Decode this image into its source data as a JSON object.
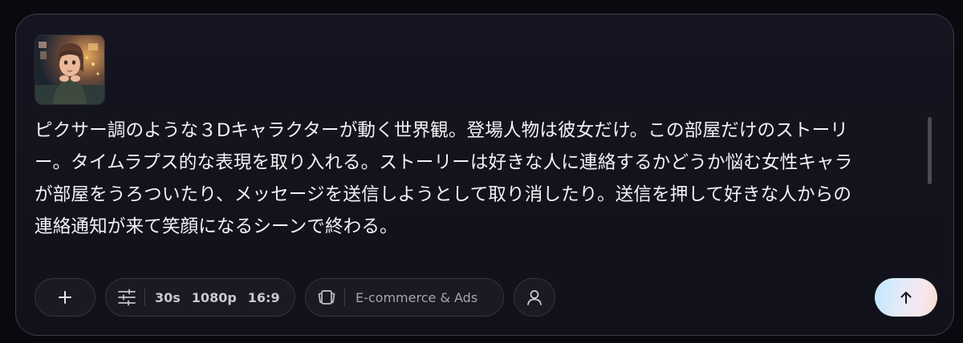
{
  "attachment": {
    "icon": "character-image-thumbnail"
  },
  "prompt": {
    "line1": "ピクサー調のような３Dキャラクターが動く世界観。登場人物は彼女だけ。この部屋だけのストーリ",
    "line2": "ー。タイムラプス的な表現を取り入れる。ストーリーは好きな人に連絡するかどうか悩む女性キャラ",
    "line3": "が部屋をうろついたり、メッセージを送信しようとして取り消したり。送信を押して好きな人からの",
    "line4": "連絡通知が来て笑顔になるシーンで終わる。"
  },
  "toolbar": {
    "add_icon": "plus-icon",
    "settings_icon": "sliders-icon",
    "duration": "30s",
    "resolution": "1080p",
    "aspect_ratio": "16:9",
    "category_icon": "cards-icon",
    "category_label": "E-commerce & Ads",
    "character_icon": "user-icon",
    "send_icon": "arrow-up-icon"
  },
  "colors": {
    "background": "#09090f",
    "panel": "#151521",
    "text": "#f2f2f5",
    "send_gradient": [
      "#bfe9ff",
      "#f7e6ef",
      "#f4dcc7"
    ]
  }
}
